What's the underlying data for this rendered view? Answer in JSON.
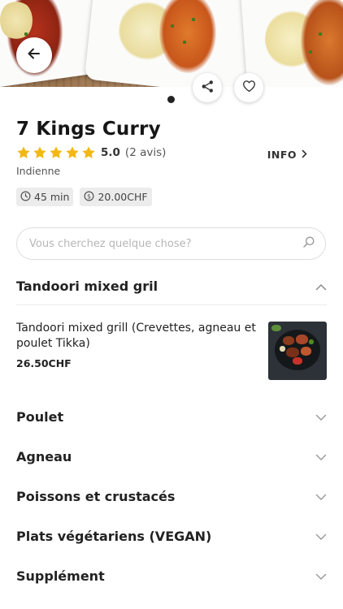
{
  "restaurant": {
    "name": "7 Kings Curry",
    "rating_value": "5.0",
    "rating_count": "(2 avis)",
    "cuisine": "Indienne",
    "delivery_time": "45 min",
    "min_order": "20.00CHF",
    "info_label": "INFO"
  },
  "search": {
    "placeholder": "Vous cherchez quelque chose?"
  },
  "open_section": {
    "label": "Tandoori mixed gril",
    "item": {
      "name": "Tandoori mixed grill (Crevettes, agneau et poulet Tikka)",
      "price": "26.50CHF"
    }
  },
  "sections": [
    {
      "label": "Poulet"
    },
    {
      "label": "Agneau"
    },
    {
      "label": "Poissons et crustacés"
    },
    {
      "label": "Plats végétariens (VEGAN)"
    },
    {
      "label": "Supplément"
    }
  ],
  "icons": {
    "back": "arrow-left-icon",
    "share": "share-icon",
    "favorite": "heart-icon",
    "rating": "star-icon",
    "time": "clock-icon",
    "money": "dollar-circle-icon",
    "search": "search-icon",
    "expand": "chevron-down-icon",
    "collapse": "chevron-up-icon"
  },
  "colors": {
    "star": "#f3b815",
    "text": "#1c1c1c",
    "muted": "#555555",
    "chip_bg": "#ececec"
  }
}
